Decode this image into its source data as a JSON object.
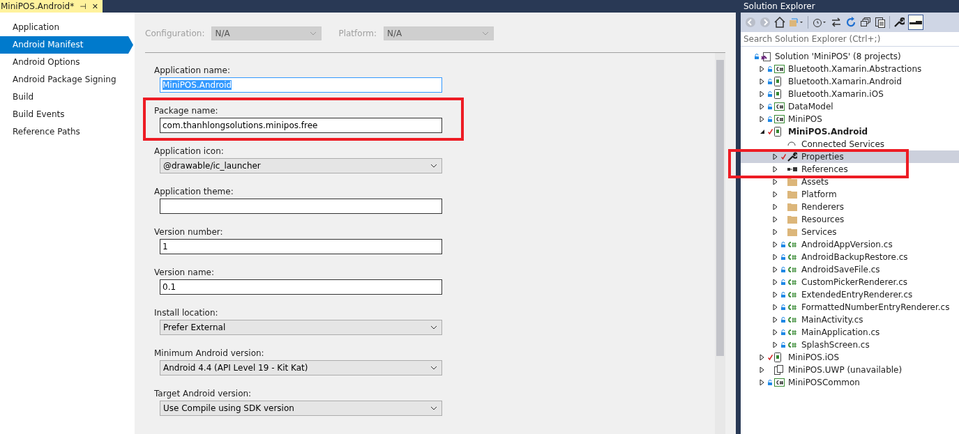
{
  "document_tab": {
    "title": "MiniPOS.Android*",
    "pin": "⊣",
    "close": "✕"
  },
  "nav": [
    {
      "label": "Application",
      "selected": false
    },
    {
      "label": "Android Manifest",
      "selected": true
    },
    {
      "label": "Android Options",
      "selected": false
    },
    {
      "label": "Android Package Signing",
      "selected": false
    },
    {
      "label": "Build",
      "selected": false
    },
    {
      "label": "Build Events",
      "selected": false
    },
    {
      "label": "Reference Paths",
      "selected": false
    }
  ],
  "toolbar": [
    {
      "label": "Configuration:",
      "value": "N/A",
      "disabled": true
    },
    {
      "label": "Platform:",
      "value": "N/A",
      "disabled": true
    }
  ],
  "fields": [
    {
      "kind": "text",
      "label": "Application name:",
      "value": "MiniPOS.Android",
      "focused": true,
      "highlighted": false
    },
    {
      "kind": "text",
      "label": "Package name:",
      "value": "com.thanhlongsolutions.minipos.free",
      "focused": false,
      "highlighted": true
    },
    {
      "kind": "select",
      "label": "Application icon:",
      "value": "@drawable/ic_launcher",
      "highlighted": false
    },
    {
      "kind": "text",
      "label": "Application theme:",
      "focused": false,
      "highlighted": false
    },
    {
      "kind": "text",
      "label": "Version number:",
      "value": "1",
      "focused": false,
      "highlighted": false
    },
    {
      "kind": "text",
      "label": "Version name:",
      "value": "0.1",
      "focused": false,
      "highlighted": false
    },
    {
      "kind": "select",
      "label": "Install location:",
      "value": "Prefer External",
      "highlighted": false
    },
    {
      "kind": "select",
      "label": "Minimum Android version:",
      "value": "Android 4.4 (API Level 19 - Kit Kat)",
      "highlighted": false
    },
    {
      "kind": "select",
      "label": "Target Android version:",
      "value": "Use Compile using SDK version",
      "highlighted": false
    }
  ],
  "solution_explorer": {
    "title": "Solution Explorer",
    "search": {
      "placeholder": "Search Solution Explorer (Ctrl+;)"
    },
    "tree": [
      {
        "kind": "solution",
        "label": "Solution 'MiniPOS' (8 projects)",
        "locked": true,
        "checked_out": false,
        "selected": false,
        "bold": false,
        "highlighted": false,
        "children": [
          {
            "kind": "csharp-project",
            "label": "Bluetooth.Xamarin.Abstractions",
            "locked": true,
            "checked_out": false,
            "expanded": false,
            "selected": false,
            "bold": false,
            "highlighted": false
          },
          {
            "kind": "android-project",
            "label": "Bluetooth.Xamarin.Android",
            "locked": true,
            "checked_out": false,
            "expanded": false,
            "selected": false,
            "bold": false,
            "highlighted": false
          },
          {
            "kind": "ios-project",
            "label": "Bluetooth.Xamarin.iOS",
            "locked": true,
            "checked_out": false,
            "expanded": false,
            "selected": false,
            "bold": false,
            "highlighted": false
          },
          {
            "kind": "csharp-project",
            "label": "DataModel",
            "locked": true,
            "checked_out": false,
            "expanded": false,
            "selected": false,
            "bold": false,
            "highlighted": false
          },
          {
            "kind": "csharp-project",
            "label": "MiniPOS",
            "locked": true,
            "checked_out": false,
            "expanded": false,
            "selected": false,
            "bold": false,
            "highlighted": false
          },
          {
            "kind": "android-project",
            "label": "MiniPOS.Android",
            "locked": false,
            "checked_out": true,
            "expanded": true,
            "selected": false,
            "bold": true,
            "highlighted": false,
            "children": [
              {
                "kind": "connected",
                "label": "Connected Services",
                "locked": false,
                "checked_out": false,
                "selected": false,
                "bold": false,
                "highlighted": false
              },
              {
                "kind": "properties",
                "label": "Properties",
                "locked": false,
                "checked_out": true,
                "expanded": false,
                "selected": true,
                "bold": false,
                "highlighted": true
              },
              {
                "kind": "references",
                "label": "References",
                "locked": false,
                "checked_out": false,
                "expanded": false,
                "selected": false,
                "bold": false,
                "highlighted": true
              },
              {
                "kind": "folder",
                "label": "Assets",
                "locked": false,
                "checked_out": false,
                "expanded": false,
                "selected": false,
                "bold": false,
                "highlighted": false
              },
              {
                "kind": "folder",
                "label": "Platform",
                "locked": false,
                "checked_out": false,
                "expanded": false,
                "selected": false,
                "bold": false,
                "highlighted": false
              },
              {
                "kind": "folder",
                "label": "Renderers",
                "locked": false,
                "checked_out": false,
                "expanded": false,
                "selected": false,
                "bold": false,
                "highlighted": false
              },
              {
                "kind": "folder",
                "label": "Resources",
                "locked": false,
                "checked_out": false,
                "expanded": false,
                "selected": false,
                "bold": false,
                "highlighted": false
              },
              {
                "kind": "folder",
                "label": "Services",
                "locked": false,
                "checked_out": false,
                "expanded": false,
                "selected": false,
                "bold": false,
                "highlighted": false
              },
              {
                "kind": "csharp-file",
                "label": "AndroidAppVersion.cs",
                "locked": true,
                "checked_out": false,
                "expanded": false,
                "selected": false,
                "bold": false,
                "highlighted": false
              },
              {
                "kind": "csharp-file",
                "label": "AndroidBackupRestore.cs",
                "locked": true,
                "checked_out": false,
                "expanded": false,
                "selected": false,
                "bold": false,
                "highlighted": false
              },
              {
                "kind": "csharp-file",
                "label": "AndroidSaveFile.cs",
                "locked": true,
                "checked_out": false,
                "expanded": false,
                "selected": false,
                "bold": false,
                "highlighted": false
              },
              {
                "kind": "csharp-file",
                "label": "CustomPickerRenderer.cs",
                "locked": true,
                "checked_out": false,
                "expanded": false,
                "selected": false,
                "bold": false,
                "highlighted": false
              },
              {
                "kind": "csharp-file",
                "label": "ExtendedEntryRenderer.cs",
                "locked": true,
                "checked_out": false,
                "expanded": false,
                "selected": false,
                "bold": false,
                "highlighted": false
              },
              {
                "kind": "csharp-file",
                "label": "FormattedNumberEntryRenderer.cs",
                "locked": true,
                "checked_out": false,
                "expanded": false,
                "selected": false,
                "bold": false,
                "highlighted": false
              },
              {
                "kind": "csharp-file",
                "label": "MainActivity.cs",
                "locked": true,
                "checked_out": false,
                "expanded": false,
                "selected": false,
                "bold": false,
                "highlighted": false
              },
              {
                "kind": "csharp-file",
                "label": "MainApplication.cs",
                "locked": true,
                "checked_out": false,
                "expanded": false,
                "selected": false,
                "bold": false,
                "highlighted": false
              },
              {
                "kind": "csharp-file",
                "label": "SplashScreen.cs",
                "locked": true,
                "checked_out": false,
                "expanded": false,
                "selected": false,
                "bold": false,
                "highlighted": false
              }
            ]
          },
          {
            "kind": "ios-project",
            "label": "MiniPOS.iOS",
            "locked": false,
            "checked_out": true,
            "expanded": false,
            "selected": false,
            "bold": false,
            "highlighted": false
          },
          {
            "kind": "uwp-project",
            "label": "MiniPOS.UWP (unavailable)",
            "locked": false,
            "checked_out": false,
            "expanded": false,
            "selected": false,
            "bold": false,
            "highlighted": false
          },
          {
            "kind": "csharp-project",
            "label": "MiniPOSCommon",
            "locked": true,
            "checked_out": false,
            "expanded": false,
            "selected": false,
            "bold": false,
            "highlighted": false
          }
        ]
      }
    ]
  }
}
